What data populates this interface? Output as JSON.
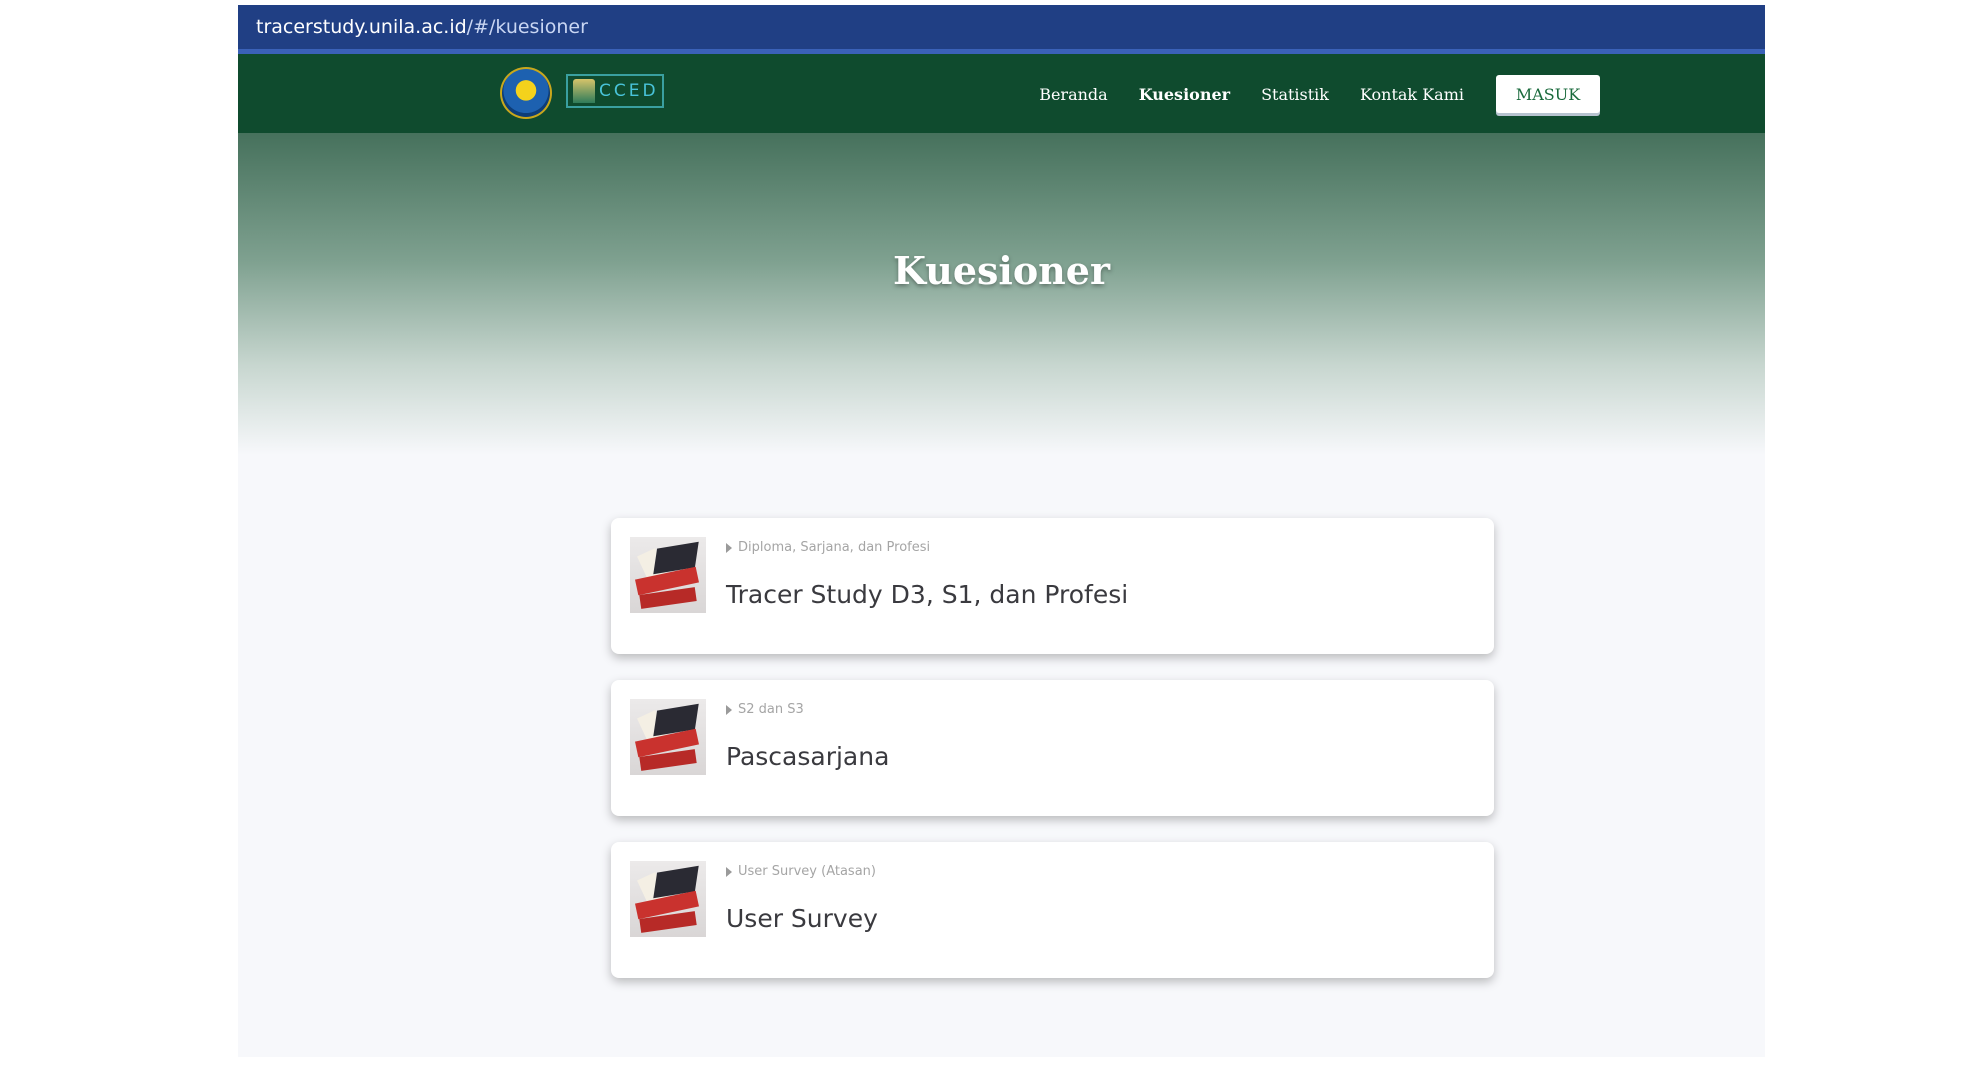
{
  "browser": {
    "url_host": "tracerstudy.unila.ac.id",
    "url_path": "/#/kuesioner"
  },
  "nav": {
    "logo_text": "CCED",
    "items": [
      {
        "label": "Beranda",
        "active": false
      },
      {
        "label": "Kuesioner",
        "active": true
      },
      {
        "label": "Statistik",
        "active": false
      },
      {
        "label": "Kontak Kami",
        "active": false
      }
    ],
    "login_label": "MASUK"
  },
  "hero": {
    "title": "Kuesioner"
  },
  "cards": [
    {
      "subtitle": "Diploma, Sarjana, dan Profesi",
      "title": "Tracer Study D3, S1, dan Profesi",
      "icon": "tracer-study-icon"
    },
    {
      "subtitle": "S2 dan S3",
      "title": "Pascasarjana",
      "icon": "tracer-study-icon"
    },
    {
      "subtitle": "User Survey (Atasan)",
      "title": "User Survey",
      "icon": "tracer-study-icon"
    }
  ],
  "colors": {
    "url_bar": "#203f84",
    "nav_bg": "#0f4b2e",
    "hero_top": "#46715c",
    "page_bg": "#f7f8fb"
  }
}
